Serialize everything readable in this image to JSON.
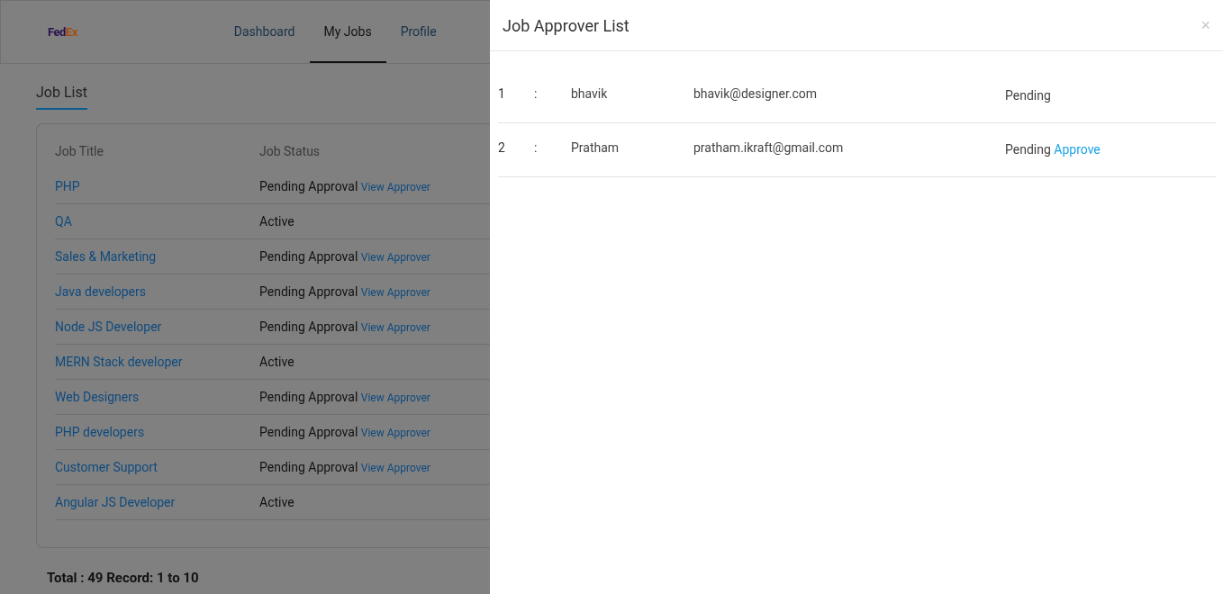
{
  "header": {
    "logo": {
      "part_1": "Fed",
      "part_2": "Ex"
    },
    "nav": [
      {
        "label": "Dashboard",
        "selected": false
      },
      {
        "label": "My Jobs",
        "selected": true
      },
      {
        "label": "Profile",
        "selected": false
      }
    ]
  },
  "job_list": {
    "title": "Job List",
    "columns": [
      "Job Title",
      "Job Status"
    ],
    "rows": [
      {
        "title": "PHP",
        "status": "Pending Approval",
        "link": "View Approver"
      },
      {
        "title": "QA",
        "status": "Active"
      },
      {
        "title": "Sales & Marketing",
        "status": "Pending Approval",
        "link": "View Approver"
      },
      {
        "title": "Java developers",
        "status": "Pending Approval",
        "link": "View Approver"
      },
      {
        "title": "Node JS Developer",
        "status": "Pending Approval",
        "link": "View Approver"
      },
      {
        "title": "MERN Stack developer",
        "status": "Active"
      },
      {
        "title": "Web Designers",
        "status": "Pending Approval",
        "link": "View Approver"
      },
      {
        "title": "PHP developers",
        "status": "Pending Approval",
        "link": "View Approver"
      },
      {
        "title": "Customer Support",
        "status": "Pending Approval",
        "link": "View Approver"
      },
      {
        "title": "Angular JS Developer",
        "status": "Active"
      }
    ],
    "total": "Total : 49 Record: 1 to 10"
  },
  "drawer": {
    "title": "Job Approver List",
    "close": "×",
    "approvers": [
      {
        "number": "1",
        "separator": ":",
        "name": "bhavik",
        "email": "bhavik@designer.com",
        "status": "Pending"
      },
      {
        "number": "2",
        "separator": ":",
        "name": "Pratham",
        "email": "pratham.ikraft@gmail.com",
        "status": "Pending",
        "action": "Approve"
      }
    ]
  }
}
